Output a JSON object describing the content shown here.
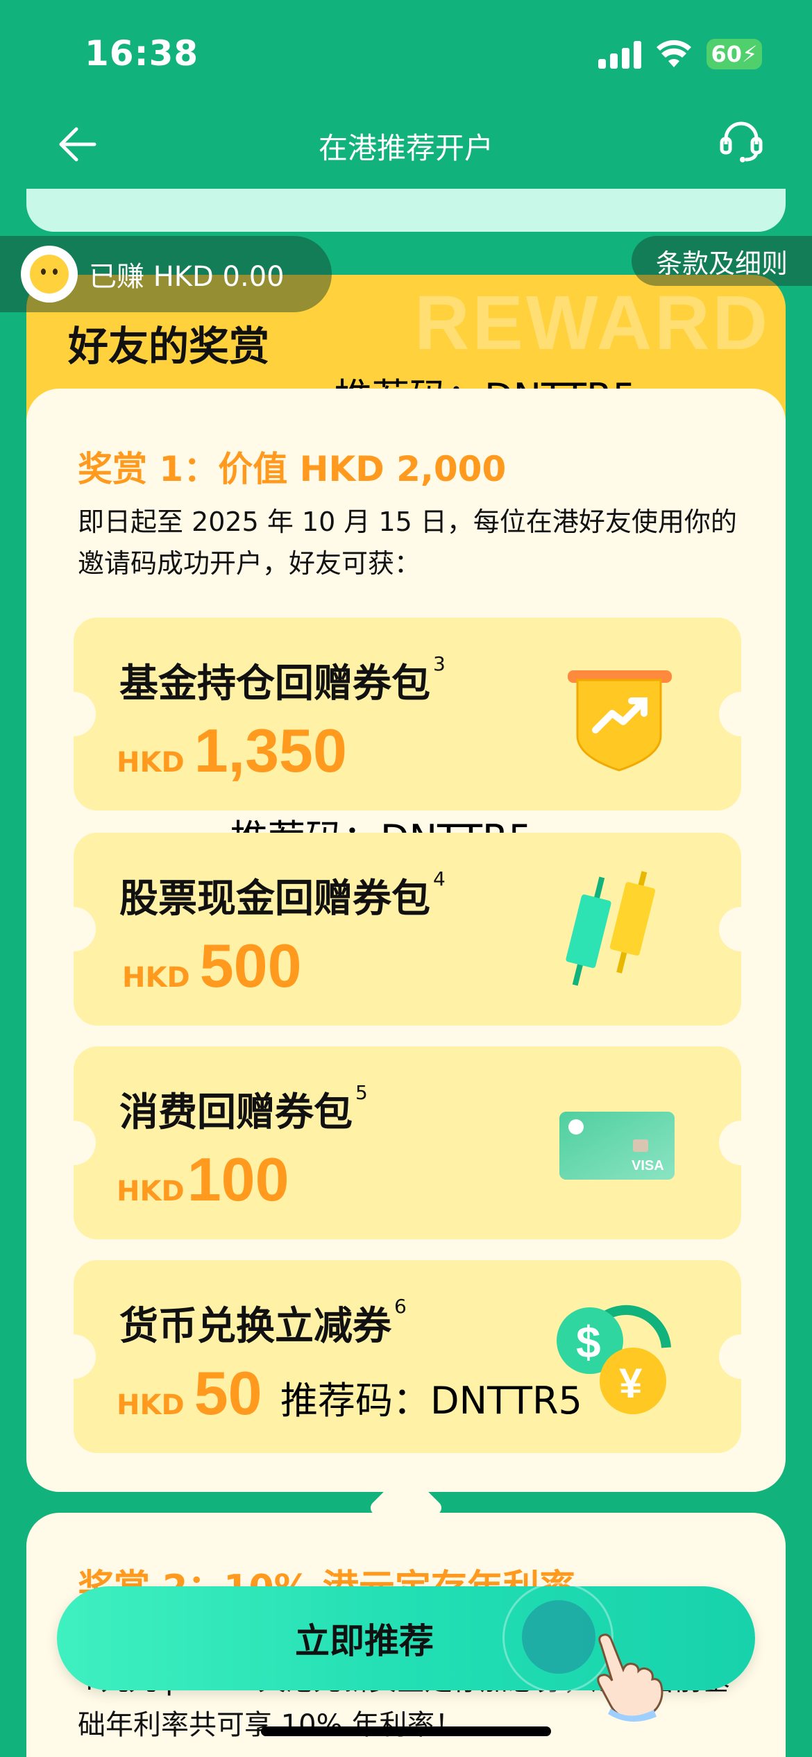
{
  "status_bar": {
    "time": "16:38",
    "battery": "60"
  },
  "nav": {
    "title": "在港推荐开户"
  },
  "earned": {
    "text": "已赚 HKD 0.00"
  },
  "terms": {
    "label": "条款及细则"
  },
  "header": {
    "watermark": "REWARD",
    "title": "好友的奖赏"
  },
  "referral_code_label": "推荐码：DNTTR5",
  "reward1": {
    "title": "奖赏 1：价值 HKD 2,000",
    "description": "即日起至 2025 年 10 月 15 日，每位在港好友使用你的邀请码成功开户，好友可获："
  },
  "coupons": [
    {
      "title": "基金持仓回赠券包",
      "note": "3",
      "currency": "HKD",
      "amount": "1,350",
      "icon": "fund-shield-icon"
    },
    {
      "title": "股票现金回赠券包",
      "note": "4",
      "currency": "HKD",
      "amount": "500",
      "icon": "stock-candles-icon"
    },
    {
      "title": "消费回赠券包",
      "note": "5",
      "currency": "HKD",
      "amount": "100",
      "icon": "visa-card-icon"
    },
    {
      "title": "货币兑换立减券",
      "note": "6",
      "currency": "HKD",
      "amount": "50",
      "icon": "currency-exchange-icon"
    }
  ],
  "reward2": {
    "title": "奖赏 2：10% 港元定存年利率",
    "description": "+九九 plus 7 天港元新资金定存加息劵，连同当前基础年利率共可享 10% 年利率！"
  },
  "cta": {
    "label": "立即推荐"
  },
  "colors": {
    "brand_green": "#12b27c",
    "accent_orange": "#ff9a1f",
    "header_yellow": "#ffd23d",
    "coupon_bg": "#fff1a6"
  }
}
